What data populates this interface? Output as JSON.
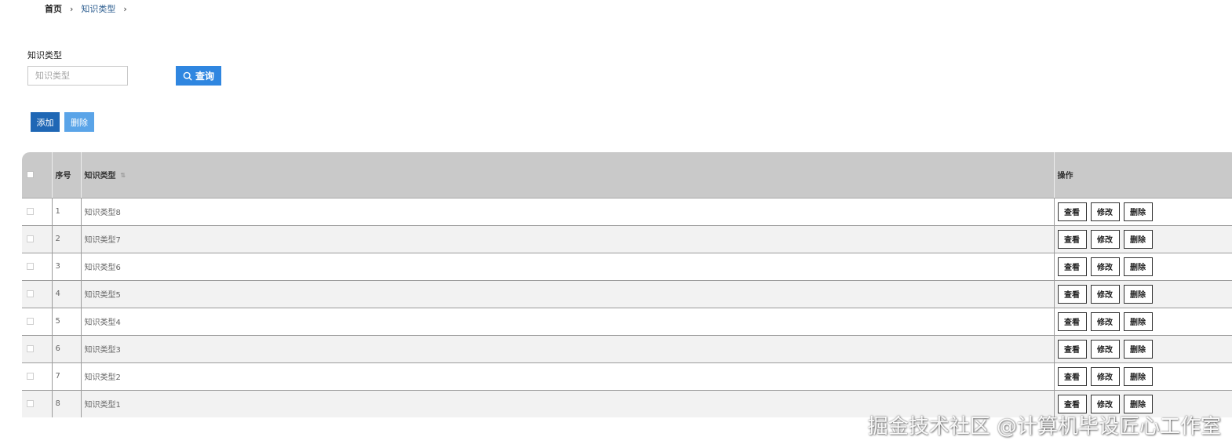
{
  "breadcrumb": {
    "home": "首页",
    "current": "知识类型",
    "separator": "›"
  },
  "filter": {
    "label": "知识类型",
    "placeholder": "知识类型",
    "search_label": "查询"
  },
  "toolbar": {
    "add_label": "添加",
    "delete_label": "删除"
  },
  "table": {
    "columns": {
      "index": "序号",
      "name": "知识类型",
      "ops": "操作"
    },
    "rows": [
      {
        "index": "1",
        "name": "知识类型8"
      },
      {
        "index": "2",
        "name": "知识类型7"
      },
      {
        "index": "3",
        "name": "知识类型6"
      },
      {
        "index": "4",
        "name": "知识类型5"
      },
      {
        "index": "5",
        "name": "知识类型4"
      },
      {
        "index": "6",
        "name": "知识类型3"
      },
      {
        "index": "7",
        "name": "知识类型2"
      },
      {
        "index": "8",
        "name": "知识类型1"
      }
    ],
    "actions": {
      "view": "查看",
      "edit": "修改",
      "delete": "删除"
    }
  },
  "watermark": "掘金技术社区 @计算机毕设匠心工作室",
  "colors": {
    "primary": "#2f86e0",
    "add_button": "#1f67b5",
    "delete_button": "#5aa4e8",
    "header_bg": "#c9c9c9",
    "link": "#2c5d8f"
  },
  "icons": {
    "search_button": "search-icon",
    "sort": "sort-icon"
  }
}
